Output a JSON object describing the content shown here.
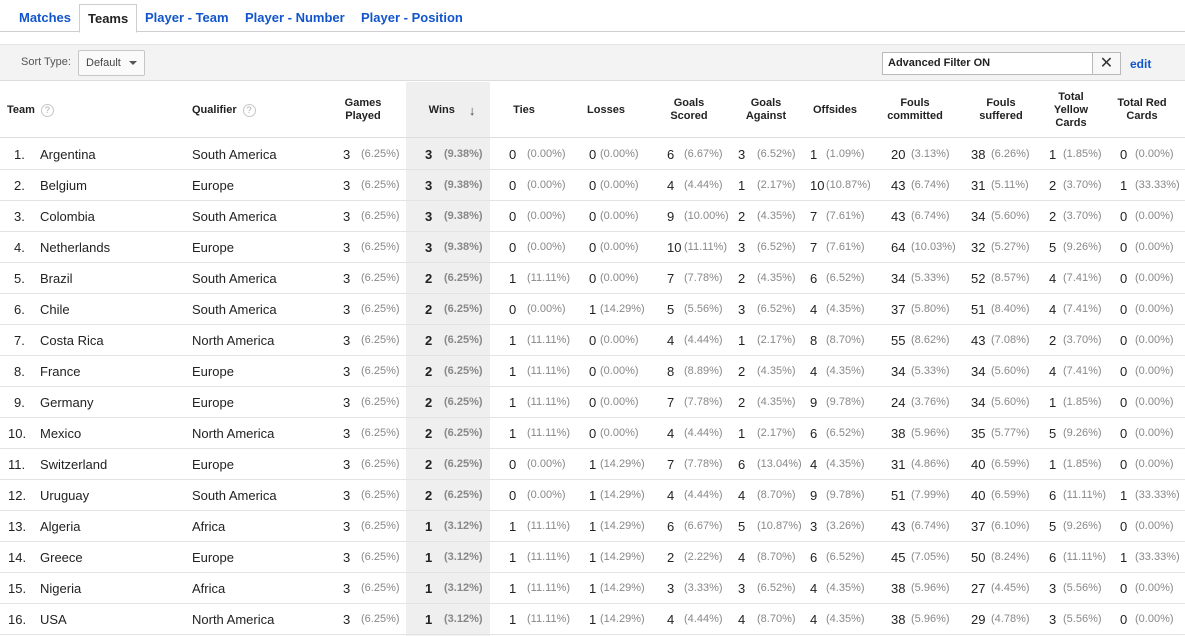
{
  "tabs": [
    {
      "label": "Matches"
    },
    {
      "label": "Teams"
    },
    {
      "label": "Player - Team"
    },
    {
      "label": "Player - Number"
    },
    {
      "label": "Player - Position"
    }
  ],
  "toolbar": {
    "sort_label": "Sort Type:",
    "sort_value": "Default",
    "filter_value": "Advanced Filter ON",
    "clear_glyph": "✕",
    "edit_label": "edit"
  },
  "headers": {
    "team": "Team",
    "qualifier": "Qualifier",
    "help_glyph": "?",
    "games_played": "Games Played",
    "wins": "Wins",
    "sort_arrow": "↓",
    "ties": "Ties",
    "losses": "Losses",
    "goals_scored": "Goals Scored",
    "goals_against": "Goals Against",
    "offsides": "Offsides",
    "fouls_committed": "Fouls committed",
    "fouls_suffered": "Fouls suffered",
    "total_yellow_cards": "Total Yellow Cards",
    "total_red_cards": "Total Red Cards"
  },
  "rows": [
    {
      "rank": "1.",
      "team": "Argentina",
      "qualifier": "South America",
      "gp": [
        "3",
        "(6.25%)"
      ],
      "wins": [
        "3",
        "(9.38%)"
      ],
      "ties": [
        "0",
        "(0.00%)"
      ],
      "losses": [
        "0",
        "(0.00%)"
      ],
      "gs": [
        "6",
        "(6.67%)"
      ],
      "ga": [
        "3",
        "(6.52%)"
      ],
      "off": [
        "1",
        "(1.09%)"
      ],
      "fc": [
        "20",
        "(3.13%)"
      ],
      "fs": [
        "38",
        "(6.26%)"
      ],
      "yc": [
        "1",
        "(1.85%)"
      ],
      "rc": [
        "0",
        "(0.00%)"
      ]
    },
    {
      "rank": "2.",
      "team": "Belgium",
      "qualifier": "Europe",
      "gp": [
        "3",
        "(6.25%)"
      ],
      "wins": [
        "3",
        "(9.38%)"
      ],
      "ties": [
        "0",
        "(0.00%)"
      ],
      "losses": [
        "0",
        "(0.00%)"
      ],
      "gs": [
        "4",
        "(4.44%)"
      ],
      "ga": [
        "1",
        "(2.17%)"
      ],
      "off": [
        "10",
        "(10.87%)"
      ],
      "fc": [
        "43",
        "(6.74%)"
      ],
      "fs": [
        "31",
        "(5.11%)"
      ],
      "yc": [
        "2",
        "(3.70%)"
      ],
      "rc": [
        "1",
        "(33.33%)"
      ]
    },
    {
      "rank": "3.",
      "team": "Colombia",
      "qualifier": "South America",
      "gp": [
        "3",
        "(6.25%)"
      ],
      "wins": [
        "3",
        "(9.38%)"
      ],
      "ties": [
        "0",
        "(0.00%)"
      ],
      "losses": [
        "0",
        "(0.00%)"
      ],
      "gs": [
        "9",
        "(10.00%)"
      ],
      "ga": [
        "2",
        "(4.35%)"
      ],
      "off": [
        "7",
        "(7.61%)"
      ],
      "fc": [
        "43",
        "(6.74%)"
      ],
      "fs": [
        "34",
        "(5.60%)"
      ],
      "yc": [
        "2",
        "(3.70%)"
      ],
      "rc": [
        "0",
        "(0.00%)"
      ]
    },
    {
      "rank": "4.",
      "team": "Netherlands",
      "qualifier": "Europe",
      "gp": [
        "3",
        "(6.25%)"
      ],
      "wins": [
        "3",
        "(9.38%)"
      ],
      "ties": [
        "0",
        "(0.00%)"
      ],
      "losses": [
        "0",
        "(0.00%)"
      ],
      "gs": [
        "10",
        "(11.11%)"
      ],
      "ga": [
        "3",
        "(6.52%)"
      ],
      "off": [
        "7",
        "(7.61%)"
      ],
      "fc": [
        "64",
        "(10.03%)"
      ],
      "fs": [
        "32",
        "(5.27%)"
      ],
      "yc": [
        "5",
        "(9.26%)"
      ],
      "rc": [
        "0",
        "(0.00%)"
      ]
    },
    {
      "rank": "5.",
      "team": "Brazil",
      "qualifier": "South America",
      "gp": [
        "3",
        "(6.25%)"
      ],
      "wins": [
        "2",
        "(6.25%)"
      ],
      "ties": [
        "1",
        "(11.11%)"
      ],
      "losses": [
        "0",
        "(0.00%)"
      ],
      "gs": [
        "7",
        "(7.78%)"
      ],
      "ga": [
        "2",
        "(4.35%)"
      ],
      "off": [
        "6",
        "(6.52%)"
      ],
      "fc": [
        "34",
        "(5.33%)"
      ],
      "fs": [
        "52",
        "(8.57%)"
      ],
      "yc": [
        "4",
        "(7.41%)"
      ],
      "rc": [
        "0",
        "(0.00%)"
      ]
    },
    {
      "rank": "6.",
      "team": "Chile",
      "qualifier": "South America",
      "gp": [
        "3",
        "(6.25%)"
      ],
      "wins": [
        "2",
        "(6.25%)"
      ],
      "ties": [
        "0",
        "(0.00%)"
      ],
      "losses": [
        "1",
        "(14.29%)"
      ],
      "gs": [
        "5",
        "(5.56%)"
      ],
      "ga": [
        "3",
        "(6.52%)"
      ],
      "off": [
        "4",
        "(4.35%)"
      ],
      "fc": [
        "37",
        "(5.80%)"
      ],
      "fs": [
        "51",
        "(8.40%)"
      ],
      "yc": [
        "4",
        "(7.41%)"
      ],
      "rc": [
        "0",
        "(0.00%)"
      ]
    },
    {
      "rank": "7.",
      "team": "Costa Rica",
      "qualifier": "North America",
      "gp": [
        "3",
        "(6.25%)"
      ],
      "wins": [
        "2",
        "(6.25%)"
      ],
      "ties": [
        "1",
        "(11.11%)"
      ],
      "losses": [
        "0",
        "(0.00%)"
      ],
      "gs": [
        "4",
        "(4.44%)"
      ],
      "ga": [
        "1",
        "(2.17%)"
      ],
      "off": [
        "8",
        "(8.70%)"
      ],
      "fc": [
        "55",
        "(8.62%)"
      ],
      "fs": [
        "43",
        "(7.08%)"
      ],
      "yc": [
        "2",
        "(3.70%)"
      ],
      "rc": [
        "0",
        "(0.00%)"
      ]
    },
    {
      "rank": "8.",
      "team": "France",
      "qualifier": "Europe",
      "gp": [
        "3",
        "(6.25%)"
      ],
      "wins": [
        "2",
        "(6.25%)"
      ],
      "ties": [
        "1",
        "(11.11%)"
      ],
      "losses": [
        "0",
        "(0.00%)"
      ],
      "gs": [
        "8",
        "(8.89%)"
      ],
      "ga": [
        "2",
        "(4.35%)"
      ],
      "off": [
        "4",
        "(4.35%)"
      ],
      "fc": [
        "34",
        "(5.33%)"
      ],
      "fs": [
        "34",
        "(5.60%)"
      ],
      "yc": [
        "4",
        "(7.41%)"
      ],
      "rc": [
        "0",
        "(0.00%)"
      ]
    },
    {
      "rank": "9.",
      "team": "Germany",
      "qualifier": "Europe",
      "gp": [
        "3",
        "(6.25%)"
      ],
      "wins": [
        "2",
        "(6.25%)"
      ],
      "ties": [
        "1",
        "(11.11%)"
      ],
      "losses": [
        "0",
        "(0.00%)"
      ],
      "gs": [
        "7",
        "(7.78%)"
      ],
      "ga": [
        "2",
        "(4.35%)"
      ],
      "off": [
        "9",
        "(9.78%)"
      ],
      "fc": [
        "24",
        "(3.76%)"
      ],
      "fs": [
        "34",
        "(5.60%)"
      ],
      "yc": [
        "1",
        "(1.85%)"
      ],
      "rc": [
        "0",
        "(0.00%)"
      ]
    },
    {
      "rank": "10.",
      "team": "Mexico",
      "qualifier": "North America",
      "gp": [
        "3",
        "(6.25%)"
      ],
      "wins": [
        "2",
        "(6.25%)"
      ],
      "ties": [
        "1",
        "(11.11%)"
      ],
      "losses": [
        "0",
        "(0.00%)"
      ],
      "gs": [
        "4",
        "(4.44%)"
      ],
      "ga": [
        "1",
        "(2.17%)"
      ],
      "off": [
        "6",
        "(6.52%)"
      ],
      "fc": [
        "38",
        "(5.96%)"
      ],
      "fs": [
        "35",
        "(5.77%)"
      ],
      "yc": [
        "5",
        "(9.26%)"
      ],
      "rc": [
        "0",
        "(0.00%)"
      ]
    },
    {
      "rank": "11.",
      "team": "Switzerland",
      "qualifier": "Europe",
      "gp": [
        "3",
        "(6.25%)"
      ],
      "wins": [
        "2",
        "(6.25%)"
      ],
      "ties": [
        "0",
        "(0.00%)"
      ],
      "losses": [
        "1",
        "(14.29%)"
      ],
      "gs": [
        "7",
        "(7.78%)"
      ],
      "ga": [
        "6",
        "(13.04%)"
      ],
      "off": [
        "4",
        "(4.35%)"
      ],
      "fc": [
        "31",
        "(4.86%)"
      ],
      "fs": [
        "40",
        "(6.59%)"
      ],
      "yc": [
        "1",
        "(1.85%)"
      ],
      "rc": [
        "0",
        "(0.00%)"
      ]
    },
    {
      "rank": "12.",
      "team": "Uruguay",
      "qualifier": "South America",
      "gp": [
        "3",
        "(6.25%)"
      ],
      "wins": [
        "2",
        "(6.25%)"
      ],
      "ties": [
        "0",
        "(0.00%)"
      ],
      "losses": [
        "1",
        "(14.29%)"
      ],
      "gs": [
        "4",
        "(4.44%)"
      ],
      "ga": [
        "4",
        "(8.70%)"
      ],
      "off": [
        "9",
        "(9.78%)"
      ],
      "fc": [
        "51",
        "(7.99%)"
      ],
      "fs": [
        "40",
        "(6.59%)"
      ],
      "yc": [
        "6",
        "(11.11%)"
      ],
      "rc": [
        "1",
        "(33.33%)"
      ]
    },
    {
      "rank": "13.",
      "team": "Algeria",
      "qualifier": "Africa",
      "gp": [
        "3",
        "(6.25%)"
      ],
      "wins": [
        "1",
        "(3.12%)"
      ],
      "ties": [
        "1",
        "(11.11%)"
      ],
      "losses": [
        "1",
        "(14.29%)"
      ],
      "gs": [
        "6",
        "(6.67%)"
      ],
      "ga": [
        "5",
        "(10.87%)"
      ],
      "off": [
        "3",
        "(3.26%)"
      ],
      "fc": [
        "43",
        "(6.74%)"
      ],
      "fs": [
        "37",
        "(6.10%)"
      ],
      "yc": [
        "5",
        "(9.26%)"
      ],
      "rc": [
        "0",
        "(0.00%)"
      ]
    },
    {
      "rank": "14.",
      "team": "Greece",
      "qualifier": "Europe",
      "gp": [
        "3",
        "(6.25%)"
      ],
      "wins": [
        "1",
        "(3.12%)"
      ],
      "ties": [
        "1",
        "(11.11%)"
      ],
      "losses": [
        "1",
        "(14.29%)"
      ],
      "gs": [
        "2",
        "(2.22%)"
      ],
      "ga": [
        "4",
        "(8.70%)"
      ],
      "off": [
        "6",
        "(6.52%)"
      ],
      "fc": [
        "45",
        "(7.05%)"
      ],
      "fs": [
        "50",
        "(8.24%)"
      ],
      "yc": [
        "6",
        "(11.11%)"
      ],
      "rc": [
        "1",
        "(33.33%)"
      ]
    },
    {
      "rank": "15.",
      "team": "Nigeria",
      "qualifier": "Africa",
      "gp": [
        "3",
        "(6.25%)"
      ],
      "wins": [
        "1",
        "(3.12%)"
      ],
      "ties": [
        "1",
        "(11.11%)"
      ],
      "losses": [
        "1",
        "(14.29%)"
      ],
      "gs": [
        "3",
        "(3.33%)"
      ],
      "ga": [
        "3",
        "(6.52%)"
      ],
      "off": [
        "4",
        "(4.35%)"
      ],
      "fc": [
        "38",
        "(5.96%)"
      ],
      "fs": [
        "27",
        "(4.45%)"
      ],
      "yc": [
        "3",
        "(5.56%)"
      ],
      "rc": [
        "0",
        "(0.00%)"
      ]
    },
    {
      "rank": "16.",
      "team": "USA",
      "qualifier": "North America",
      "gp": [
        "3",
        "(6.25%)"
      ],
      "wins": [
        "1",
        "(3.12%)"
      ],
      "ties": [
        "1",
        "(11.11%)"
      ],
      "losses": [
        "1",
        "(14.29%)"
      ],
      "gs": [
        "4",
        "(4.44%)"
      ],
      "ga": [
        "4",
        "(8.70%)"
      ],
      "off": [
        "4",
        "(4.35%)"
      ],
      "fc": [
        "38",
        "(5.96%)"
      ],
      "fs": [
        "29",
        "(4.78%)"
      ],
      "yc": [
        "3",
        "(5.56%)"
      ],
      "rc": [
        "0",
        "(0.00%)"
      ]
    }
  ]
}
